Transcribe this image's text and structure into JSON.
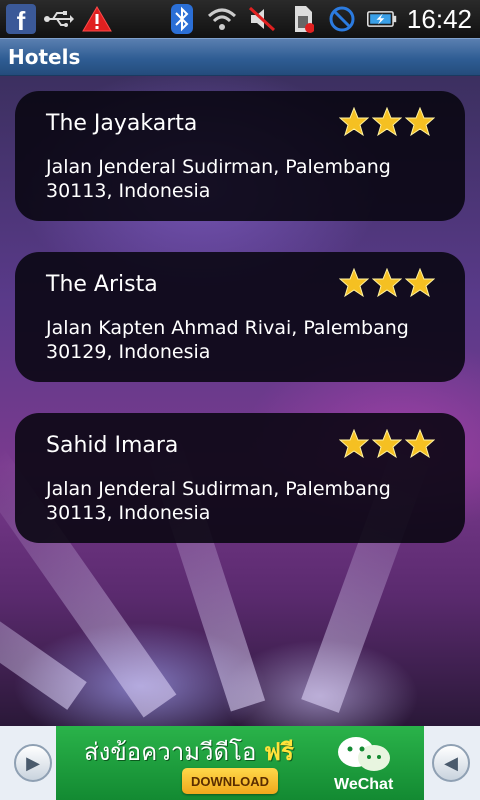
{
  "status_bar": {
    "time": "16:42",
    "icons": [
      "facebook-icon",
      "usb-icon",
      "warning-icon",
      "bluetooth-icon",
      "wifi-icon",
      "mute-icon",
      "sim-icon",
      "no-signal-icon",
      "battery-charging-icon"
    ]
  },
  "title_bar": {
    "title": "Hotels"
  },
  "hotels": [
    {
      "name": "The Jayakarta",
      "address": "Jalan Jenderal Sudirman, Palembang 30113, Indonesia",
      "stars": 3
    },
    {
      "name": "The Arista",
      "address": "Jalan Kapten Ahmad Rivai, Palembang 30129, Indonesia",
      "stars": 3
    },
    {
      "name": "Sahid Imara",
      "address": "Jalan Jenderal Sudirman, Palembang 30113, Indonesia",
      "stars": 3
    }
  ],
  "ad": {
    "headline": "ส่งข้อความวีดีโอ",
    "headline_free": "ฟรี",
    "download_label": "DOWNLOAD",
    "brand": "WeChat",
    "brand_color": "#2ab34a"
  }
}
